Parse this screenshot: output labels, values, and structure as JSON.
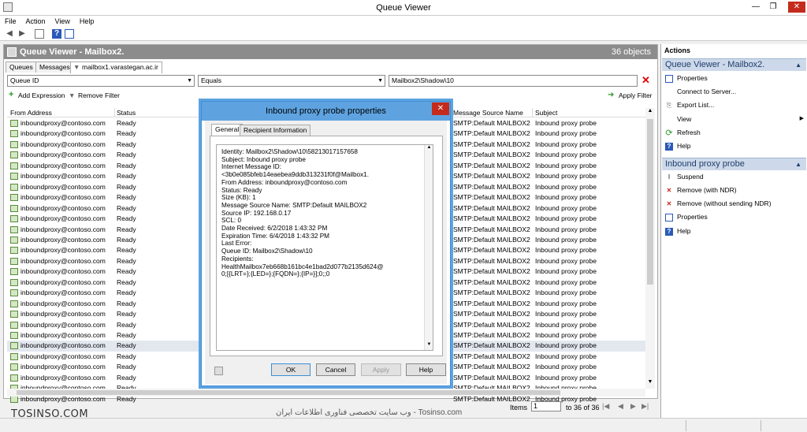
{
  "window": {
    "title": "Queue Viewer"
  },
  "menu": [
    "File",
    "Action",
    "View",
    "Help"
  ],
  "pane": {
    "title": "Queue Viewer - Mailbox2.",
    "object_count": "36 objects"
  },
  "tabs": [
    "Queues",
    "Messages",
    "mailbox1.varastegan.ac.ir"
  ],
  "filter": {
    "field": "Queue ID",
    "operator": "Equals",
    "value": "Mailbox2\\Shadow\\10"
  },
  "toolbar2": {
    "add_expression": "Add Expression",
    "remove_filter": "Remove Filter",
    "apply_filter": "Apply Filter"
  },
  "columns": {
    "from_address": "From Address",
    "status": "Status",
    "source_name": "Message Source Name",
    "subject": "Subject"
  },
  "rows": [
    {
      "from": "inboundproxy@contoso.com",
      "status": "Ready",
      "source": "SMTP:Default MAILBOX2",
      "subject": "Inbound proxy probe"
    },
    {
      "from": "inboundproxy@contoso.com",
      "status": "Ready",
      "source": "SMTP:Default MAILBOX2",
      "subject": "Inbound proxy probe"
    },
    {
      "from": "inboundproxy@contoso.com",
      "status": "Ready",
      "source": "SMTP:Default MAILBOX2",
      "subject": "Inbound proxy probe"
    },
    {
      "from": "inboundproxy@contoso.com",
      "status": "Ready",
      "source": "SMTP:Default MAILBOX2",
      "subject": "Inbound proxy probe"
    },
    {
      "from": "inboundproxy@contoso.com",
      "status": "Ready",
      "source": "SMTP:Default MAILBOX2",
      "subject": "Inbound proxy probe"
    },
    {
      "from": "inboundproxy@contoso.com",
      "status": "Ready",
      "source": "SMTP:Default MAILBOX2",
      "subject": "Inbound proxy probe"
    },
    {
      "from": "inboundproxy@contoso.com",
      "status": "Ready",
      "source": "SMTP:Default MAILBOX2",
      "subject": "Inbound proxy probe"
    },
    {
      "from": "inboundproxy@contoso.com",
      "status": "Ready",
      "source": "SMTP:Default MAILBOX2",
      "subject": "Inbound proxy probe"
    },
    {
      "from": "inboundproxy@contoso.com",
      "status": "Ready",
      "source": "SMTP:Default MAILBOX2",
      "subject": "Inbound proxy probe"
    },
    {
      "from": "inboundproxy@contoso.com",
      "status": "Ready",
      "source": "SMTP:Default MAILBOX2",
      "subject": "Inbound proxy probe"
    },
    {
      "from": "inboundproxy@contoso.com",
      "status": "Ready",
      "source": "SMTP:Default MAILBOX2",
      "subject": "Inbound proxy probe"
    },
    {
      "from": "inboundproxy@contoso.com",
      "status": "Ready",
      "source": "SMTP:Default MAILBOX2",
      "subject": "Inbound proxy probe"
    },
    {
      "from": "inboundproxy@contoso.com",
      "status": "Ready",
      "source": "SMTP:Default MAILBOX2",
      "subject": "Inbound proxy probe"
    },
    {
      "from": "inboundproxy@contoso.com",
      "status": "Ready",
      "source": "SMTP:Default MAILBOX2",
      "subject": "Inbound proxy probe"
    },
    {
      "from": "inboundproxy@contoso.com",
      "status": "Ready",
      "source": "SMTP:Default MAILBOX2",
      "subject": "Inbound proxy probe"
    },
    {
      "from": "inboundproxy@contoso.com",
      "status": "Ready",
      "source": "SMTP:Default MAILBOX2",
      "subject": "Inbound proxy probe"
    },
    {
      "from": "inboundproxy@contoso.com",
      "status": "Ready",
      "source": "SMTP:Default MAILBOX2",
      "subject": "Inbound proxy probe"
    },
    {
      "from": "inboundproxy@contoso.com",
      "status": "Ready",
      "source": "SMTP:Default MAILBOX2",
      "subject": "Inbound proxy probe"
    },
    {
      "from": "inboundproxy@contoso.com",
      "status": "Ready",
      "source": "SMTP:Default MAILBOX2",
      "subject": "Inbound proxy probe"
    },
    {
      "from": "inboundproxy@contoso.com",
      "status": "Ready",
      "source": "SMTP:Default MAILBOX2",
      "subject": "Inbound proxy probe"
    },
    {
      "from": "inboundproxy@contoso.com",
      "status": "Ready",
      "source": "SMTP:Default MAILBOX2",
      "subject": "Inbound proxy probe"
    },
    {
      "from": "inboundproxy@contoso.com",
      "status": "Ready",
      "source": "SMTP:Default MAILBOX2",
      "subject": "Inbound proxy probe",
      "selected": true
    },
    {
      "from": "inboundproxy@contoso.com",
      "status": "Ready",
      "source": "SMTP:Default MAILBOX2",
      "subject": "Inbound proxy probe"
    },
    {
      "from": "inboundproxy@contoso.com",
      "status": "Ready",
      "source": "SMTP:Default MAILBOX2",
      "subject": "Inbound proxy probe"
    },
    {
      "from": "inboundproxy@contoso.com",
      "status": "Ready",
      "source": "SMTP:Default MAILBOX2",
      "subject": "Inbound proxy probe"
    },
    {
      "from": "inboundproxy@contoso.com",
      "status": "Ready",
      "source": "SMTP:Default MAILBOX2",
      "subject": "Inbound proxy probe"
    },
    {
      "from": "inboundproxy@contoso.com",
      "status": "Ready",
      "source": "SMTP:Default MAILBOX2",
      "subject": "Inbound proxy probe"
    }
  ],
  "footer": {
    "watermark": "TOSINSO.COM",
    "watermark_fa": "وب سایت تخصصی فناوری اطلاعات ایران - Tosinso.com",
    "items_label": "Items",
    "items_value": "1",
    "page_count": "to 36 of 36"
  },
  "actions": {
    "title": "Actions",
    "section1": "Queue Viewer - Mailbox2.",
    "section1_items": [
      "Properties",
      "Connect to Server...",
      "Export List...",
      "View",
      "Refresh",
      "Help"
    ],
    "section2": "Inbound proxy probe",
    "section2_items": [
      "Suspend",
      "Remove (with NDR)",
      "Remove (without sending NDR)",
      "Properties",
      "Help"
    ]
  },
  "dialog": {
    "title": "Inbound proxy probe properties",
    "tabs": [
      "General",
      "Recipient Information"
    ],
    "lines": [
      "Identity: Mailbox2\\Shadow\\10\\58213017157658",
      "Subject: Inbound proxy probe",
      "Internet Message ID:",
      "<3b0e085bfeb14eaebea9ddb313231f0f@Mailbox1.",
      "From Address: inboundproxy@contoso.com",
      "Status: Ready",
      "Size (KB): 1",
      "Message Source Name: SMTP:Default MAILBOX2",
      "Source IP: 192.168.0.17",
      "SCL: 0",
      "Date Received: 6/2/2018 1:43:32 PM",
      "Expiration Time: 6/4/2018 1:43:32 PM",
      "Last Error:",
      "Queue ID: Mailbox2\\Shadow\\10",
      "Recipients:",
      "HealthMailbox7eb668b161bc4e1bad2d077b2135d624@",
      "0;[{LRT=};{LED=};{FQDN=};{IP=}];0;;0"
    ],
    "buttons": {
      "ok": "OK",
      "cancel": "Cancel",
      "apply": "Apply",
      "help": "Help"
    }
  }
}
